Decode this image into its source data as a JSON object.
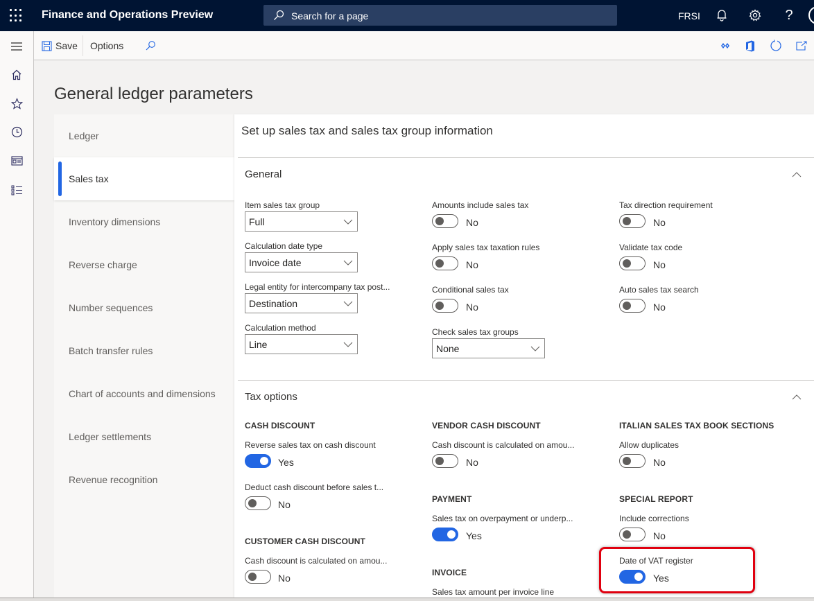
{
  "topbar": {
    "app_title": "Finance and Operations Preview",
    "search_placeholder": "Search for a page",
    "company": "FRSI",
    "icons": [
      "waffle-icon",
      "search-icon",
      "bell-icon",
      "gear-icon",
      "help-icon",
      "avatar-icon"
    ]
  },
  "rail": {
    "items": [
      "hamburger-menu-icon",
      "home-icon",
      "favorites-star-icon",
      "recent-clock-icon",
      "workspaces-icon",
      "modules-list-icon"
    ]
  },
  "actionpane": {
    "save_label": "Save",
    "options_label": "Options",
    "right_icons": [
      "power-apps-icon",
      "office-icon",
      "refresh-icon",
      "open-new-window-icon"
    ]
  },
  "page": {
    "title": "General ledger parameters"
  },
  "tabs": [
    {
      "label": "Ledger",
      "active": false
    },
    {
      "label": "Sales tax",
      "active": true
    },
    {
      "label": "Inventory dimensions",
      "active": false
    },
    {
      "label": "Reverse charge",
      "active": false
    },
    {
      "label": "Number sequences",
      "active": false
    },
    {
      "label": "Batch transfer rules",
      "active": false
    },
    {
      "label": "Chart of accounts and dimensions",
      "active": false
    },
    {
      "label": "Ledger settlements",
      "active": false
    },
    {
      "label": "Revenue recognition",
      "active": false
    }
  ],
  "content": {
    "title": "Set up sales tax and sales tax group information",
    "general": {
      "header": "General",
      "item_sales_tax_group": {
        "label": "Item sales tax group",
        "value": "Full"
      },
      "calculation_date_type": {
        "label": "Calculation date type",
        "value": "Invoice date"
      },
      "legal_entity": {
        "label": "Legal entity for intercompany tax post...",
        "value": "Destination"
      },
      "calculation_method": {
        "label": "Calculation method",
        "value": "Line"
      },
      "amounts_include": {
        "label": "Amounts include sales tax",
        "value": "No"
      },
      "apply_taxation_rules": {
        "label": "Apply sales tax taxation rules",
        "value": "No"
      },
      "conditional_sales_tax": {
        "label": "Conditional sales tax",
        "value": "No"
      },
      "check_sales_tax_groups": {
        "label": "Check sales tax groups",
        "value": "None"
      },
      "tax_direction": {
        "label": "Tax direction requirement",
        "value": "No"
      },
      "validate_tax_code": {
        "label": "Validate tax code",
        "value": "No"
      },
      "auto_sales_tax_search": {
        "label": "Auto sales tax search",
        "value": "No"
      }
    },
    "tax_options": {
      "header": "Tax options",
      "cash_discount": {
        "group": "CASH DISCOUNT",
        "reverse": {
          "label": "Reverse sales tax on cash discount",
          "value": "Yes"
        },
        "deduct": {
          "label": "Deduct cash discount before sales t...",
          "value": "No"
        }
      },
      "customer_cash_discount": {
        "group": "CUSTOMER CASH DISCOUNT",
        "calculated": {
          "label": "Cash discount is calculated on amou...",
          "value": "No"
        }
      },
      "vendor_cash_discount": {
        "group": "VENDOR CASH DISCOUNT",
        "calculated": {
          "label": "Cash discount is calculated on amou...",
          "value": "No"
        }
      },
      "payment": {
        "group": "PAYMENT",
        "overpayment": {
          "label": "Sales tax on overpayment or underp...",
          "value": "Yes"
        }
      },
      "invoice": {
        "group": "INVOICE",
        "per_line": {
          "label": "Sales tax amount per invoice line"
        }
      },
      "italian_book": {
        "group": "ITALIAN SALES TAX BOOK SECTIONS",
        "allow_duplicates": {
          "label": "Allow duplicates",
          "value": "No"
        }
      },
      "special_report": {
        "group": "SPECIAL REPORT",
        "include_corrections": {
          "label": "Include corrections",
          "value": "No"
        },
        "date_of_vat_register": {
          "label": "Date of VAT register",
          "value": "Yes"
        }
      }
    }
  },
  "colors": {
    "topbar": "#001433",
    "accent": "#2266e3",
    "highlight": "#e0000f"
  }
}
